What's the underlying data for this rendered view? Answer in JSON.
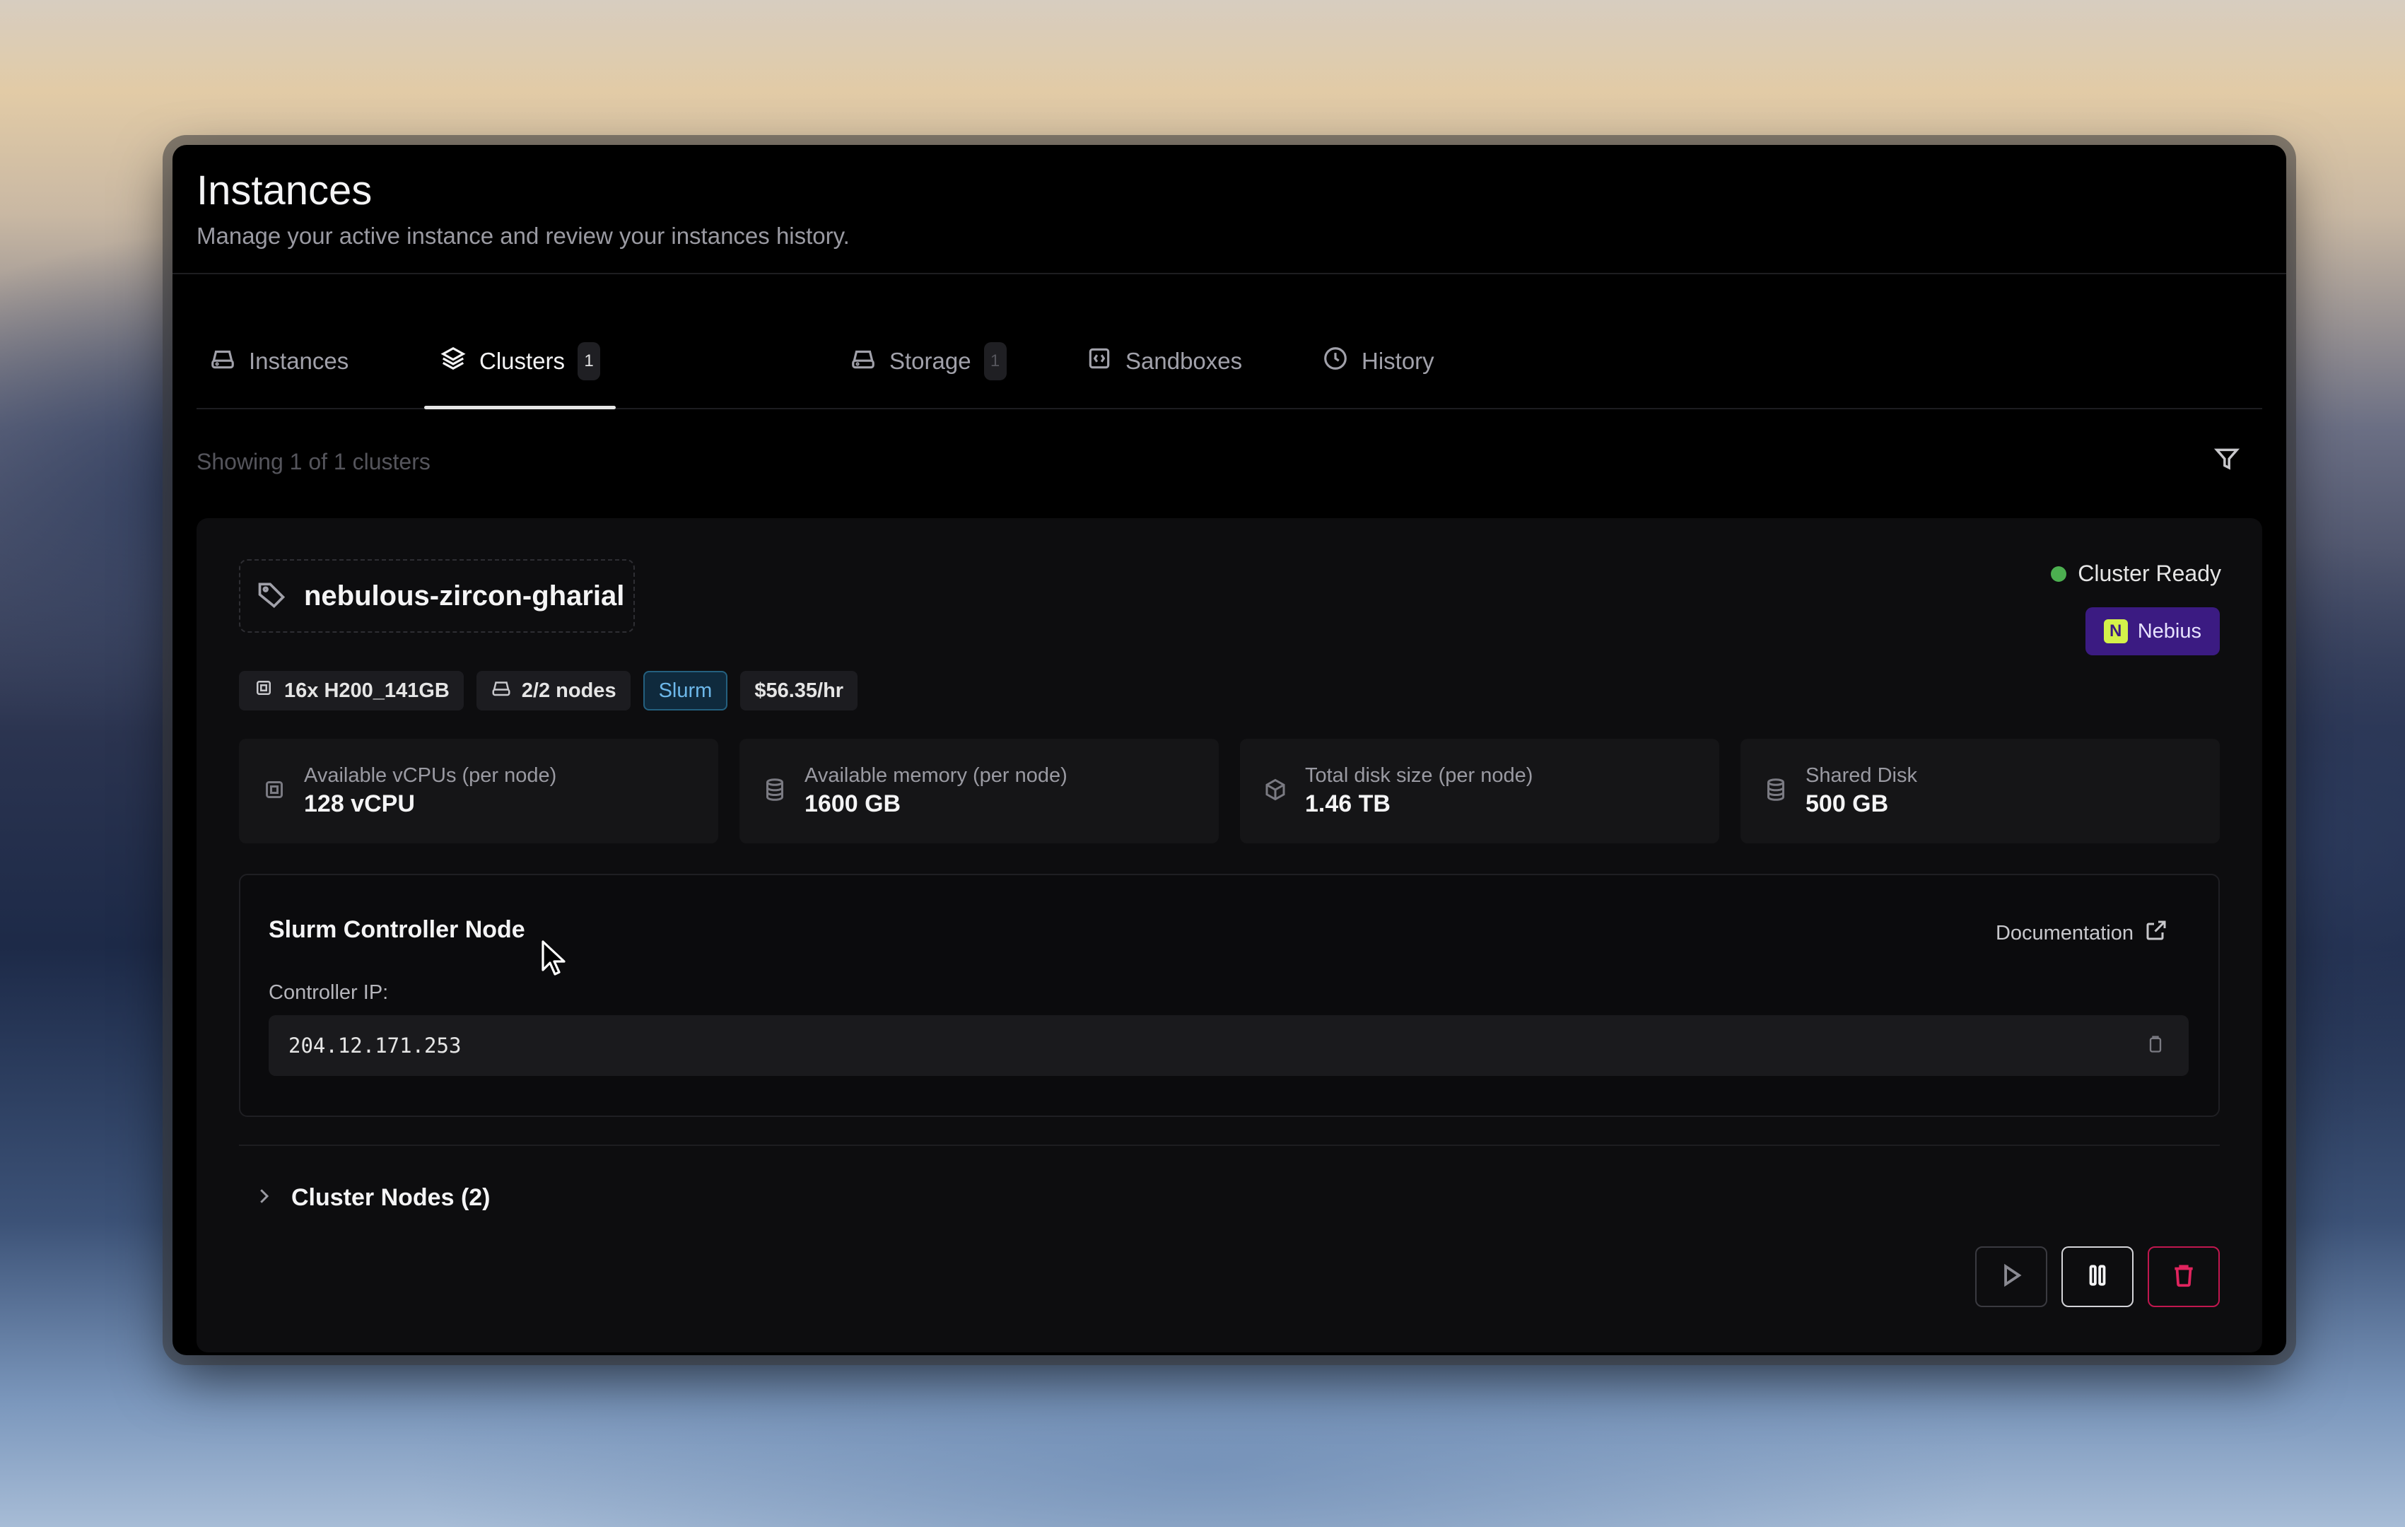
{
  "page": {
    "title": "Instances",
    "subtitle": "Manage your active instance and review your instances history."
  },
  "tabs": [
    {
      "label": "Instances",
      "icon": "server-icon",
      "active": false
    },
    {
      "label": "Clusters",
      "icon": "layers-icon",
      "count": "1",
      "active": true
    },
    {
      "label": "Storage",
      "icon": "server-icon",
      "count": "1",
      "active": false
    },
    {
      "label": "Sandboxes",
      "icon": "code-box-icon",
      "active": false
    },
    {
      "label": "History",
      "icon": "clock-icon",
      "active": false
    }
  ],
  "list": {
    "showing": "Showing 1 of 1 clusters"
  },
  "cluster": {
    "name": "nebulous-zircon-gharial",
    "status": "Cluster Ready",
    "provider": "Nebius",
    "provider_logo": "N",
    "badges": {
      "gpu": "16x H200_141GB",
      "nodes": "2/2 nodes",
      "scheduler": "Slurm",
      "price": "$56.35/hr"
    },
    "stats": [
      {
        "label": "Available vCPUs (per node)",
        "value": "128 vCPU",
        "icon": "cpu-icon"
      },
      {
        "label": "Available memory (per node)",
        "value": "1600 GB",
        "icon": "database-icon"
      },
      {
        "label": "Total disk size (per node)",
        "value": "1.46 TB",
        "icon": "box-icon"
      },
      {
        "label": "Shared Disk",
        "value": "500 GB",
        "icon": "database-icon"
      }
    ],
    "controller": {
      "title": "Slurm Controller Node",
      "doc_label": "Documentation",
      "ip_label": "Controller IP:",
      "ip": "204.12.171.253"
    },
    "nodes_label": "Cluster Nodes (2)"
  },
  "colors": {
    "status_green": "#4caf50",
    "provider_bg": "#3b1b82",
    "slurm_blue": "#6db8ea",
    "delete_red": "#e0245e"
  }
}
